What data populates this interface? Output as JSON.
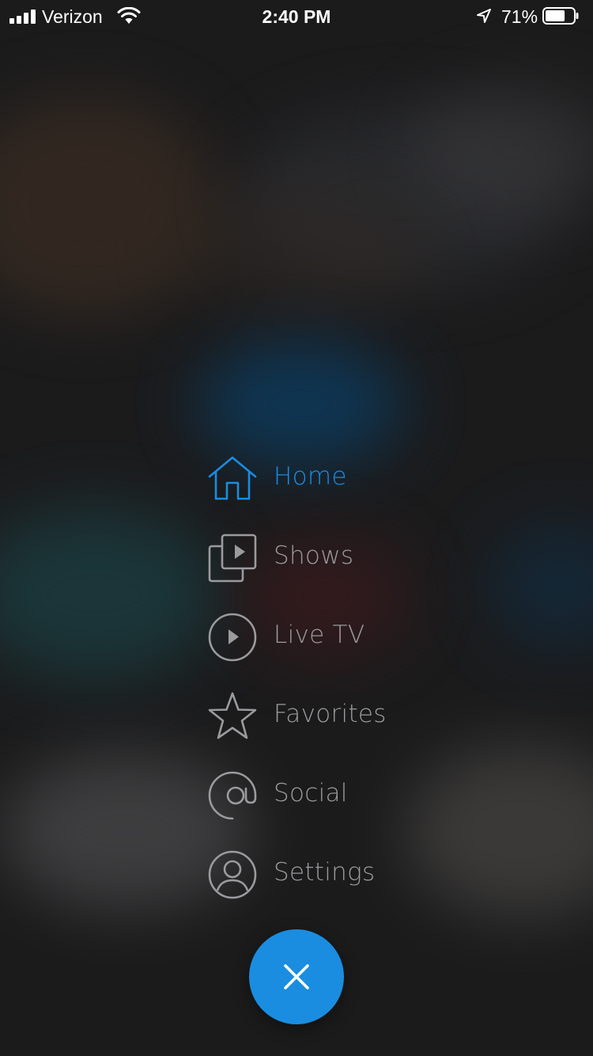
{
  "status_bar": {
    "carrier": "Verizon",
    "time": "2:40 PM",
    "battery_percent": "71%",
    "battery_level": 0.71,
    "icons": [
      "signal-icon",
      "wifi-icon",
      "location-arrow-icon",
      "battery-icon"
    ]
  },
  "menu": {
    "accent_color": "#1a8de0",
    "inactive_color": "#9b9b9e",
    "items": [
      {
        "label": "Home",
        "icon": "home-icon",
        "active": true
      },
      {
        "label": "Shows",
        "icon": "shows-icon",
        "active": false
      },
      {
        "label": "Live TV",
        "icon": "play-circle-icon",
        "active": false
      },
      {
        "label": "Favorites",
        "icon": "star-icon",
        "active": false
      },
      {
        "label": "Social",
        "icon": "at-sign-icon",
        "active": false
      },
      {
        "label": "Settings",
        "icon": "user-circle-icon",
        "active": false
      }
    ]
  },
  "close_button": {
    "icon": "close-icon",
    "color": "#1a8de0"
  }
}
